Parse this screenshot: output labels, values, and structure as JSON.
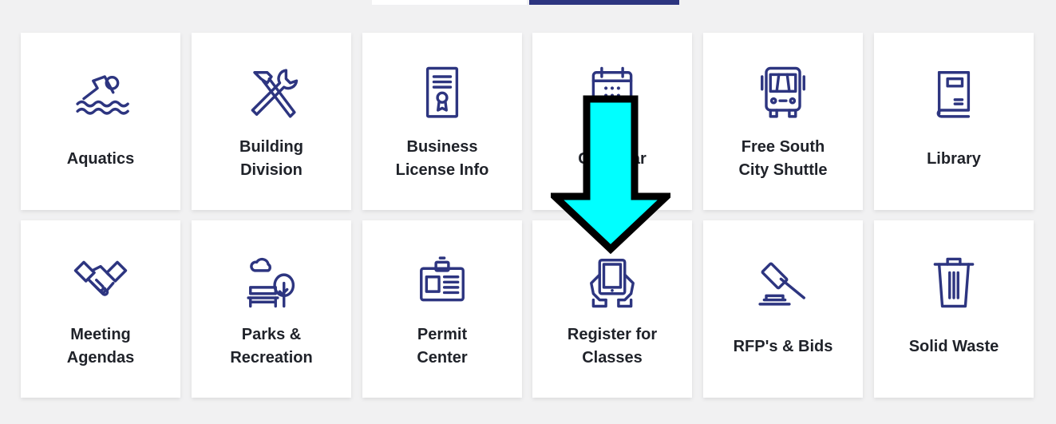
{
  "colors": {
    "accent": "#2d3580",
    "page_background": "#f1f1f2",
    "tile_background": "#ffffff",
    "label_text": "#1f2229",
    "annotation_arrow_fill": "#00ffff",
    "annotation_arrow_stroke": "#000000"
  },
  "tiles": [
    {
      "id": "aquatics",
      "icon": "swimmer-icon",
      "lines": [
        "Aquatics"
      ]
    },
    {
      "id": "building-division",
      "icon": "hammer-wrench-icon",
      "lines": [
        "Building",
        "Division"
      ]
    },
    {
      "id": "business-license-info",
      "icon": "certificate-icon",
      "lines": [
        "Business",
        "License Info"
      ]
    },
    {
      "id": "calendar",
      "icon": "calendar-icon",
      "lines": [
        "Calendar"
      ]
    },
    {
      "id": "free-south-city-shuttle",
      "icon": "bus-icon",
      "lines": [
        "Free South",
        "City Shuttle"
      ]
    },
    {
      "id": "library",
      "icon": "book-icon",
      "lines": [
        "Library"
      ]
    },
    {
      "id": "meeting-agendas",
      "icon": "handshake-icon",
      "lines": [
        "Meeting",
        "Agendas"
      ]
    },
    {
      "id": "parks-recreation",
      "icon": "park-bench-tree-icon",
      "lines": [
        "Parks &",
        "Recreation"
      ]
    },
    {
      "id": "permit-center",
      "icon": "id-badge-icon",
      "lines": [
        "Permit",
        "Center"
      ]
    },
    {
      "id": "register-for-classes",
      "icon": "tablet-hands-icon",
      "lines": [
        "Register for",
        "Classes"
      ]
    },
    {
      "id": "rfps-bids",
      "icon": "gavel-icon",
      "lines": [
        "RFP's & Bids"
      ]
    },
    {
      "id": "solid-waste",
      "icon": "trash-can-icon",
      "lines": [
        "Solid Waste"
      ]
    }
  ],
  "annotation": {
    "icon": "down-arrow-icon"
  }
}
